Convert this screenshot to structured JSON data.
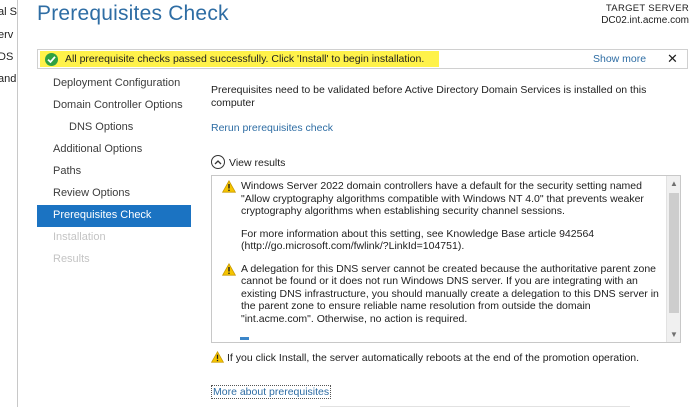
{
  "background_window": {
    "fragments": [
      "al Se",
      "erv",
      "DS",
      "and"
    ]
  },
  "page": {
    "title": "Prerequisites Check",
    "target_label": "TARGET SERVER",
    "target_server": "DC02.int.acme.com"
  },
  "banner": {
    "icon": "check-circle-icon",
    "message": "All prerequisite checks passed successfully.  Click 'Install' to begin installation.",
    "show_more": "Show more",
    "close": "✕"
  },
  "nav": {
    "items": [
      {
        "label": "Deployment Configuration",
        "state": "normal"
      },
      {
        "label": "Domain Controller Options",
        "state": "normal"
      },
      {
        "label": "DNS Options",
        "state": "sub"
      },
      {
        "label": "Additional Options",
        "state": "normal"
      },
      {
        "label": "Paths",
        "state": "normal"
      },
      {
        "label": "Review Options",
        "state": "normal"
      },
      {
        "label": "Prerequisites Check",
        "state": "active"
      },
      {
        "label": "Installation",
        "state": "disabled"
      },
      {
        "label": "Results",
        "state": "disabled"
      }
    ]
  },
  "content": {
    "intro": "Prerequisites need to be validated before Active Directory Domain Services is installed on this computer",
    "rerun": "Rerun prerequisites check",
    "view_results": "View results",
    "results": [
      {
        "icon": "warning-icon",
        "paragraphs": [
          "Windows Server 2022 domain controllers have a default for the security setting named \"Allow cryptography algorithms compatible with Windows NT 4.0\" that prevents weaker cryptography algorithms when establishing security channel sessions.",
          "For more information about this setting, see Knowledge Base article 942564 (http://go.microsoft.com/fwlink/?LinkId=104751)."
        ]
      },
      {
        "icon": "warning-icon",
        "paragraphs": [
          "A delegation for this DNS server cannot be created because the authoritative parent zone cannot be found or it does not run Windows DNS server. If you are integrating with an existing DNS infrastructure, you should manually create a delegation to this DNS server in the parent zone to ensure reliable name resolution from outside the domain \"int.acme.com\". Otherwise, no action is required."
        ]
      }
    ],
    "reboot_warning": "If you click Install, the server automatically reboots at the end of the promotion operation.",
    "more_link": "More about prerequisites"
  },
  "colors": {
    "title_blue": "#2e6da4",
    "active_nav": "#1b73c2",
    "highlight": "#fff24a",
    "success": "#2fa142",
    "warning": "#f5c400"
  }
}
